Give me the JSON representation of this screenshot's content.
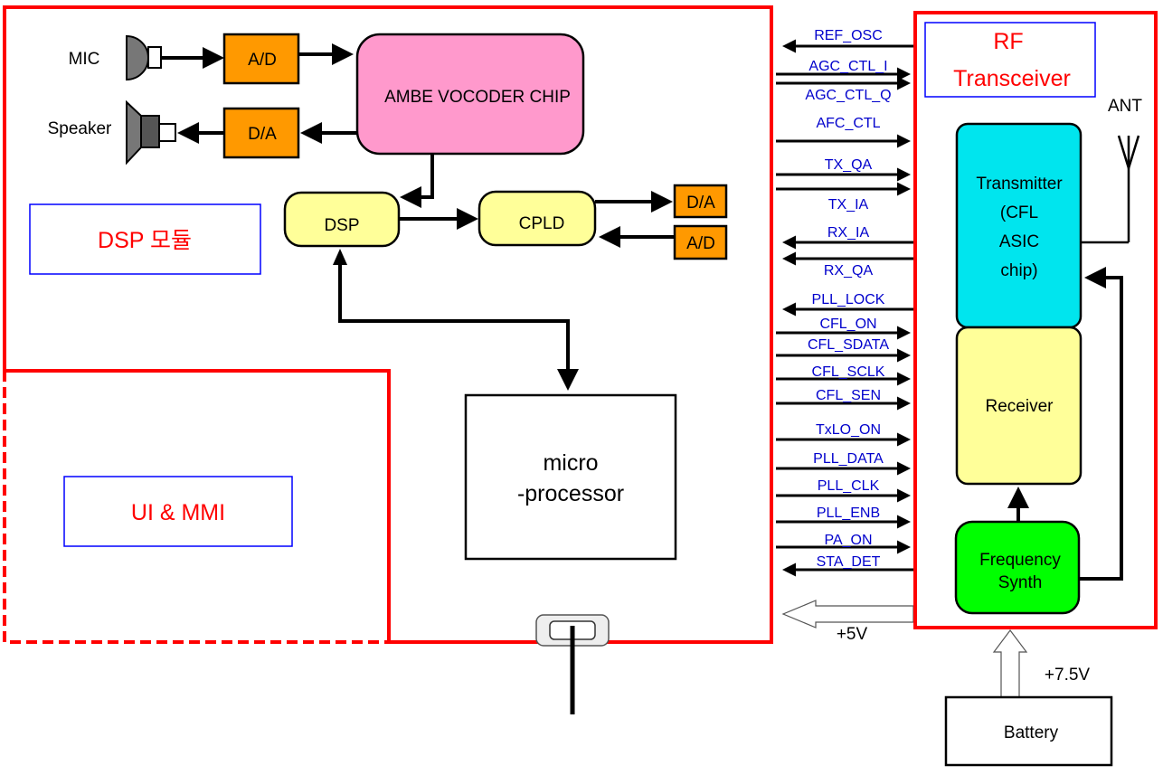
{
  "dsp_module": {
    "label": "DSP 모듈"
  },
  "ui_module": {
    "label": "UI & MMI"
  },
  "audio": {
    "mic": "MIC",
    "speaker": "Speaker",
    "ad": "A/D",
    "da": "D/A"
  },
  "vocoder": {
    "label": "AMBE VOCODER CHIP"
  },
  "dsp": {
    "label": "DSP"
  },
  "cpld": {
    "label": "CPLD",
    "da": "D/A",
    "ad": "A/D"
  },
  "micro": {
    "line1": "micro",
    "line2": "-processor"
  },
  "rf": {
    "title1": "RF",
    "title2": "Transceiver",
    "ant": "ANT"
  },
  "transmitter": {
    "line1": "Transmitter",
    "line2": "(CFL",
    "line3": "ASIC",
    "line4": "chip)"
  },
  "receiver": {
    "label": "Receiver"
  },
  "synth": {
    "line1": "Frequency",
    "line2": "Synth"
  },
  "power": {
    "v5": "+5V",
    "v75": "+7.5V",
    "battery": "Battery"
  },
  "signals": [
    {
      "label": "REF_OSC",
      "dir": "in"
    },
    {
      "label": "AGC_CTL_I",
      "dir": "out"
    },
    {
      "label": "AGC_CTL_Q",
      "dir": "out"
    },
    {
      "label": "AFC_CTL",
      "dir": "out"
    },
    {
      "label": "TX_QA",
      "dir": "out"
    },
    {
      "label": "TX_IA",
      "dir": "out"
    },
    {
      "label": "RX_IA",
      "dir": "in"
    },
    {
      "label": "RX_QA",
      "dir": "in"
    },
    {
      "label": "PLL_LOCK",
      "dir": "in"
    },
    {
      "label": "CFL_ON",
      "dir": "out"
    },
    {
      "label": "CFL_SDATA",
      "dir": "out"
    },
    {
      "label": "CFL_SCLK",
      "dir": "out"
    },
    {
      "label": "CFL_SEN",
      "dir": "out"
    },
    {
      "label": "TxLO_ON",
      "dir": "out"
    },
    {
      "label": "PLL_DATA",
      "dir": "out"
    },
    {
      "label": "PLL_CLK",
      "dir": "out"
    },
    {
      "label": "PLL_ENB",
      "dir": "out"
    },
    {
      "label": "PA_ON",
      "dir": "out"
    },
    {
      "label": "STA_DET",
      "dir": "in"
    }
  ],
  "colors": {
    "border": "#ff0000",
    "label_box": "#0000ff",
    "ad_da": "#ff9900",
    "vocoder": "#ff99cc",
    "dsp_cpld": "#ffff99",
    "transmitter": "#00e5ee",
    "receiver": "#ffff99",
    "synth": "#00ff00",
    "signal_text": "#0000cc"
  }
}
